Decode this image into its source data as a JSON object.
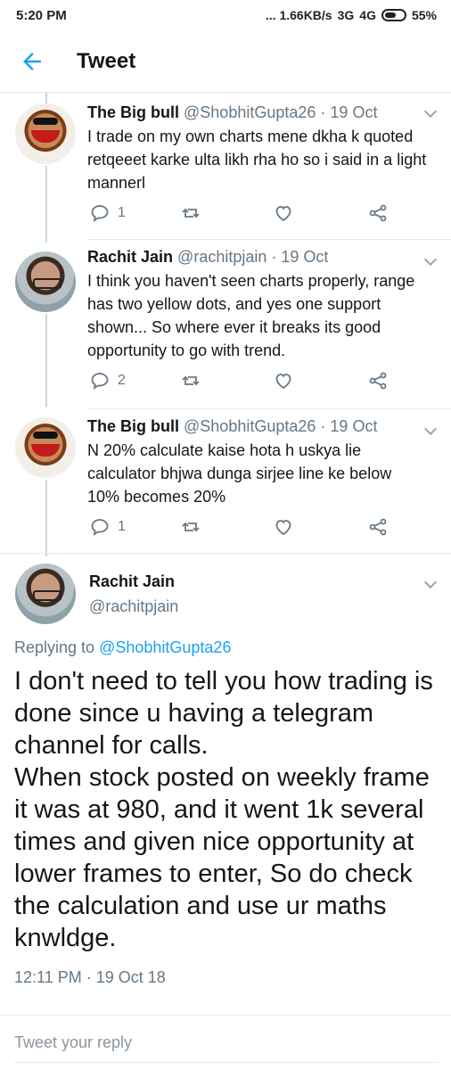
{
  "status_bar": {
    "time": "5:20 PM",
    "network_info": "... 1.66KB/s",
    "signal1": "3G",
    "signal2": "4G",
    "battery": "55%"
  },
  "app_bar": {
    "title": "Tweet"
  },
  "replies": [
    {
      "name": "The Big bull",
      "handle": "@ShobhitGupta26",
      "date": "· 19 Oct",
      "text": "I trade on my own charts mene dkha k quoted retqeeet karke ulta likh rha ho so i said in a light mannerl",
      "reply_count": "1",
      "avatar": "cartoon-avatar"
    },
    {
      "name": "Rachit Jain",
      "handle": "@rachitpjain",
      "date": "· 19 Oct",
      "text": "I think you haven't seen charts properly, range has two yellow dots, and yes one support shown... So where ever it breaks its good opportunity to go with trend.",
      "reply_count": "2",
      "avatar": "photo-avatar"
    },
    {
      "name": "The Big bull",
      "handle": "@ShobhitGupta26",
      "date": "· 19 Oct",
      "text": "N 20% calculate kaise hota h uskya lie calculator bhjwa dunga sirjee line ke below 10% becomes 20%",
      "reply_count": "1",
      "avatar": "cartoon-avatar"
    }
  ],
  "main_tweet": {
    "name": "Rachit Jain",
    "handle": "@rachitpjain",
    "replying_prefix": "Replying to",
    "replying_to": "@ShobhitGupta26",
    "text": "I don't need to tell you how trading is done since u having a telegram channel for calls.\nWhen stock posted on weekly frame it was at 980, and it went 1k several times and given nice opportunity at lower frames to enter, So do check the calculation and use ur maths knwldge.",
    "timestamp": "12:11 PM · 19 Oct 18"
  },
  "reply_box": {
    "placeholder": "Tweet your reply"
  },
  "colors": {
    "accent": "#1da1f2",
    "muted": "#657786",
    "border": "#e1e8ed"
  }
}
